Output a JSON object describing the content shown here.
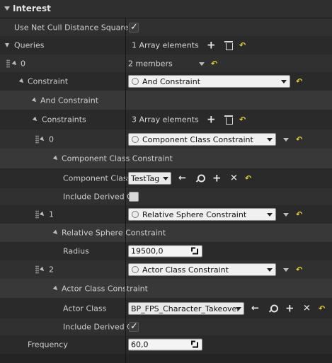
{
  "header": {
    "title": "Interest"
  },
  "rows": {
    "cull": {
      "label": "Use Net Cull Distance Squared f",
      "checked": true
    },
    "queries": {
      "label": "Queries",
      "value": "1 Array elements"
    },
    "q0": {
      "label": "0",
      "value": "2 members"
    },
    "constraint": {
      "label": "Constraint",
      "value": "And Constraint"
    },
    "and_constraint": {
      "label": "And Constraint"
    },
    "constraints": {
      "label": "Constraints",
      "value": "3 Array elements"
    },
    "c0": {
      "label": "0",
      "value": "Component Class Constraint"
    },
    "ccc_header": {
      "label": "Component Class Constraint"
    },
    "component_class": {
      "label": "Component Class",
      "value": "TestTag"
    },
    "include_derived_1": {
      "label": "Include Derived C",
      "checked": false
    },
    "c1": {
      "label": "1",
      "value": "Relative Sphere Constraint"
    },
    "rsc_header": {
      "label": "Relative Sphere Constraint"
    },
    "radius": {
      "label": "Radius",
      "value": "19500,0"
    },
    "c2": {
      "label": "2",
      "value": "Actor Class Constraint"
    },
    "acc_header": {
      "label": "Actor Class Constraint"
    },
    "actor_class": {
      "label": "Actor Class",
      "value": "BP_FPS_Character_Takeover"
    },
    "include_derived_2": {
      "label": "Include Derived C",
      "checked": true
    },
    "frequency": {
      "label": "Frequency",
      "value": "60,0"
    }
  },
  "icons": {
    "add": "+",
    "remove": "✕",
    "reset": "↶",
    "back": "←",
    "search": "search-icon",
    "trash": "trash-icon"
  },
  "colors": {
    "reset_accent": "#e6d433",
    "background": "#242424"
  }
}
